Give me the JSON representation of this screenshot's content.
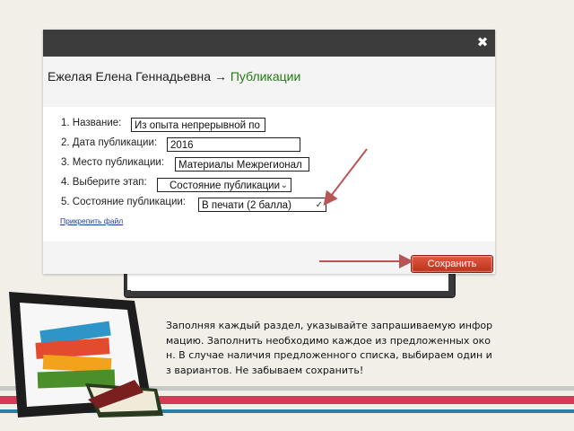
{
  "dialog": {
    "header": {
      "person": "Ежелая Елена Геннадьевна",
      "arrow": "→",
      "section": "Публикации"
    },
    "rows": [
      {
        "label": "1. Название:",
        "value": "Из опыта непрерывной по"
      },
      {
        "label": "2. Дата публикации:",
        "value": "2016"
      },
      {
        "label": "3. Место публикации:",
        "value": "Материалы Межрегионал"
      },
      {
        "label": "4. Выберите этап:",
        "value": "Состояние публикации"
      },
      {
        "label": "5. Состояние публикации:",
        "value": "В печати (2 балла)"
      }
    ],
    "attach_link": "Прикрепить файл",
    "save_label": "Сохранить",
    "close_icon": "close-icon"
  },
  "caption": "Заполняя каждый раздел, указывайте запрашиваемую инфор\nмацию. Заполнить необходимо каждое из предложенных око\nн. В случае наличия предложенного списка, выбираем один и\nз вариантов. Не забываем сохранить!",
  "colors": {
    "titlebar": "#3c3c3c",
    "accent_green": "#257a14",
    "save_button": "#d2452a",
    "pointer_arrow": "#b85555",
    "stripe_red": "#d43b57",
    "stripe_blue": "#2c7fa8",
    "stripe_grey": "#c9c9c9"
  }
}
